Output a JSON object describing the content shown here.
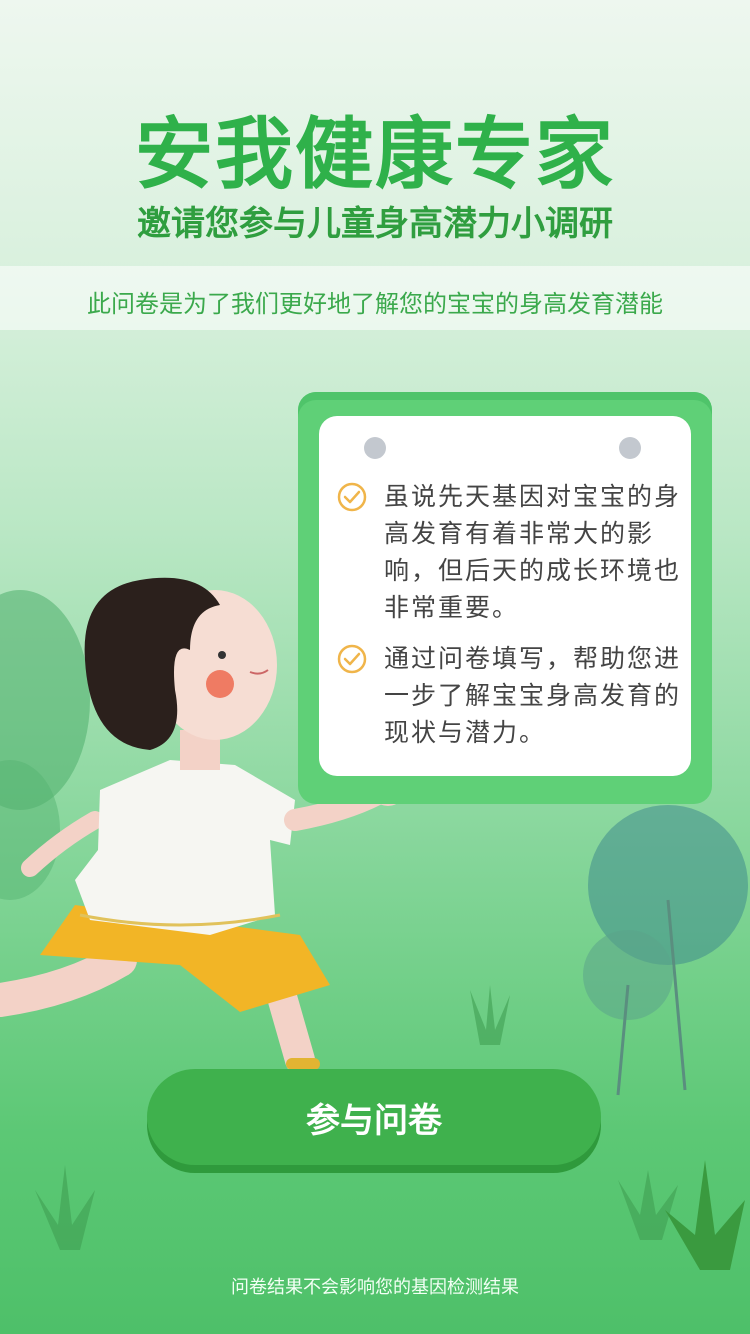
{
  "header": {
    "title": "安我健康专家",
    "subtitle": "邀请您参与儿童身高潜力小调研",
    "banner": "此问卷是为了我们更好地了解您的宝宝的身高发育潜能"
  },
  "card": {
    "items": [
      {
        "icon": "check-circle-icon",
        "text": "虽说先天基因对宝宝的身高发育有着非常大的影响，但后天的成长环境也非常重要。"
      },
      {
        "icon": "check-circle-icon",
        "text": "通过问卷填写，帮助您进一步了解宝宝身高发育的现状与潜力。"
      }
    ]
  },
  "cta": {
    "label": "参与问卷"
  },
  "footer": {
    "note": "问卷结果不会影响您的基因检测结果"
  },
  "colors": {
    "brand_green": "#2fb14a",
    "cta_green": "#3fb14d",
    "check_orange": "#f0b54a"
  }
}
